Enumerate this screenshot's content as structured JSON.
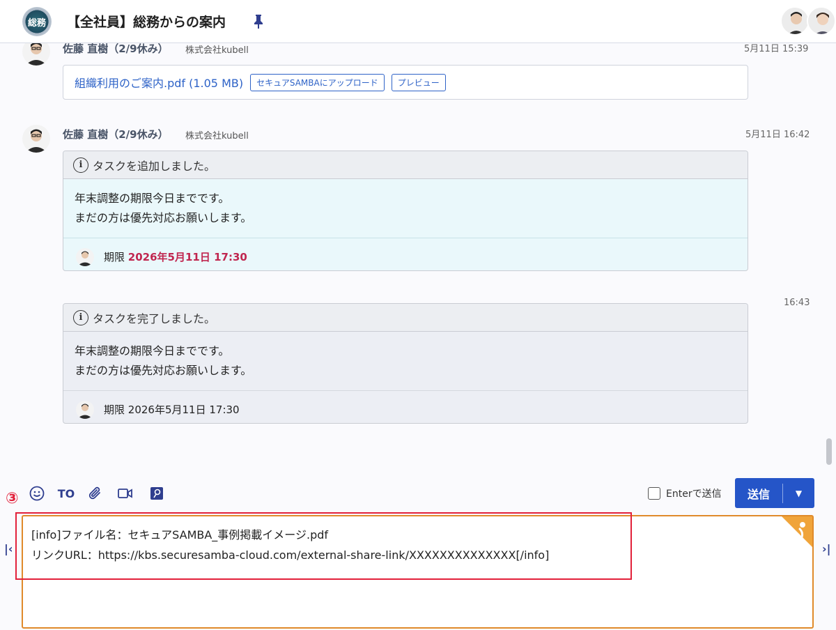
{
  "header": {
    "room_title": "【全社員】総務からの案内",
    "room_avatar_text": "総務"
  },
  "messages": [
    {
      "sender": "佐藤 直樹（2/9休み）",
      "org": "株式会社kubell",
      "time": "5月11日 15:39",
      "file": {
        "name": "組織利用のご案内.pdf (1.05 MB)",
        "upload_label": "セキュアSAMBAにアップロード",
        "preview_label": "プレビュー"
      }
    },
    {
      "sender": "佐藤 直樹（2/9休み）",
      "org": "株式会社kubell",
      "time": "5月11日 16:42",
      "task": {
        "header": "タスクを追加しました。",
        "line1": "年末調整の期限今日までです。",
        "line2": "まだの方は優先対応お願いします。",
        "deadline_label": "期限",
        "deadline_value": "2026年5月11日 17:30"
      }
    },
    {
      "time": "16:43",
      "task": {
        "header": "タスクを完了しました。",
        "line1": "年末調整の期限今日までです。",
        "line2": "まだの方は優先対応お願いします。",
        "deadline_label": "期限",
        "deadline_value": "2026年5月11日 17:30"
      }
    }
  ],
  "toolbar": {
    "to_label": "TO",
    "enter_send_label": "Enterで送信",
    "send_label": "送信"
  },
  "marker": "③",
  "composer": {
    "line1": "[info]ファイル名：セキュアSAMBA_事例掲載イメージ.pdf",
    "line2": "リンクURL：https://kbs.securesamba-cloud.com/external-share-link/XXXXXXXXXXXXXX[/info]"
  },
  "colors": {
    "accent": "#2555c8",
    "deadline_red": "#c0264f",
    "highlight_red": "#e2203a",
    "composer_border": "#e08a2a"
  },
  "icons": [
    "pin-icon",
    "emoji-icon",
    "attach-icon",
    "video-icon",
    "help-key-icon",
    "info-icon",
    "chevron-down-icon"
  ]
}
